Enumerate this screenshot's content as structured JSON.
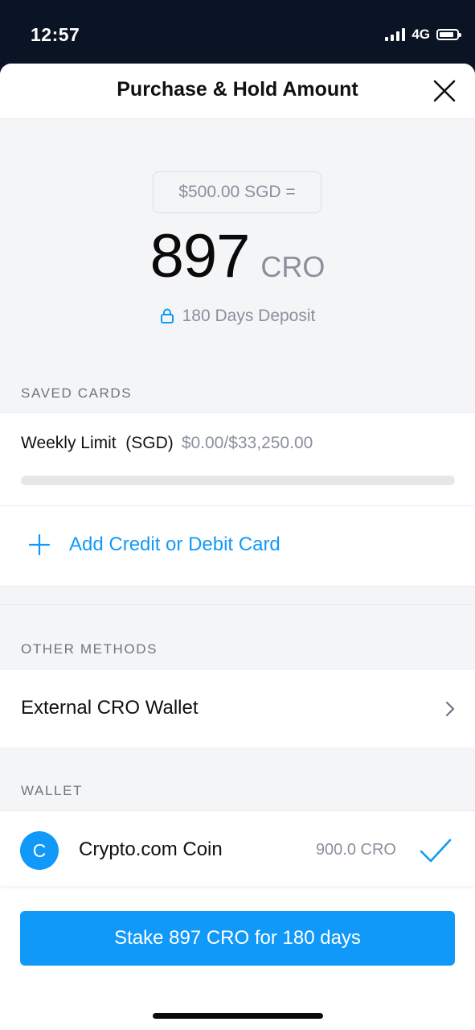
{
  "status": {
    "time": "12:57",
    "network": "4G"
  },
  "header": {
    "title": "Purchase & Hold Amount",
    "close_icon": "close-icon"
  },
  "amount": {
    "fiat": "$500.00 SGD =",
    "value": "897",
    "unit": "CRO",
    "deposit_label": "180 Days Deposit",
    "deposit_icon": "lock-icon"
  },
  "saved_cards": {
    "label": "SAVED CARDS",
    "weekly_limit_label": "Weekly Limit  (SGD)",
    "weekly_limit_value": "$0.00/$33,250.00",
    "weekly_limit_used_fraction": 0,
    "add_card_label": "Add Credit or Debit Card"
  },
  "other_methods": {
    "label": "OTHER METHODS",
    "external_wallet_label": "External CRO Wallet"
  },
  "wallet": {
    "label": "WALLET",
    "coin_initial": "C",
    "coin_name": "Crypto.com Coin",
    "coin_balance": "900.0 CRO",
    "selected": true
  },
  "footer": {
    "stake_button_label": "Stake 897 CRO for 180 days"
  },
  "colors": {
    "accent": "#1199fa",
    "status_bar_bg": "#0b1424",
    "muted_text": "#8a909c"
  }
}
